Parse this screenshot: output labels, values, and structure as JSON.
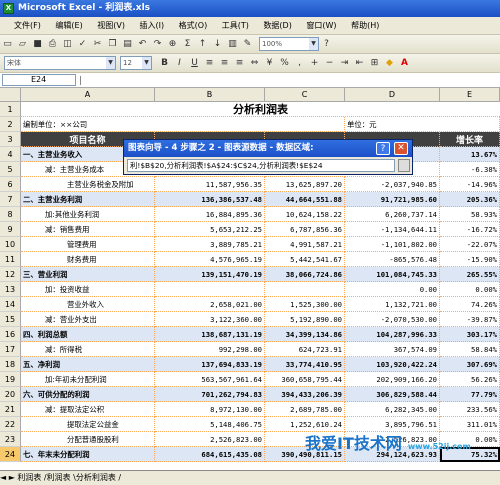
{
  "window": {
    "title": "Microsoft Excel - 利润表.xls"
  },
  "menu": [
    "文件(F)",
    "编辑(E)",
    "视图(V)",
    "插入(I)",
    "格式(O)",
    "工具(T)",
    "数据(D)",
    "窗口(W)",
    "帮助(H)"
  ],
  "toolbar": {
    "zoom": "100%",
    "font": "宋体",
    "size": "12"
  },
  "formula_bar": {
    "name_box": "E24"
  },
  "columns": [
    "A",
    "B",
    "C",
    "D",
    "E"
  ],
  "sheet": {
    "title": "分析利润表",
    "unit_label": "编制单位：××公司",
    "unit_right": "单位：元",
    "header_a": "项目名称",
    "header_e": "增长率"
  },
  "rows": [
    {
      "n": "4",
      "a": "一、主营业务收入",
      "b": "",
      "c": "",
      "d": "",
      "e": "13.67%",
      "bold": true
    },
    {
      "n": "5",
      "a": "减：主营业务成本",
      "b": "",
      "c": "",
      "d": "",
      "e": "-6.38%",
      "indent": 1
    },
    {
      "n": "6",
      "a": "主营业务税金及附加",
      "b": "11,587,956.35",
      "c": "13,625,897.20",
      "d": "-2,037,940.85",
      "e": "-14.96%",
      "indent": 2
    },
    {
      "n": "7",
      "a": "二、主营业务利润",
      "b": "136,386,537.48",
      "c": "44,664,551.88",
      "d": "91,721,985.60",
      "e": "205.36%",
      "bold": true
    },
    {
      "n": "8",
      "a": "加:其他业务利润",
      "b": "16,884,895.36",
      "c": "10,624,158.22",
      "d": "6,260,737.14",
      "e": "58.93%",
      "indent": 1
    },
    {
      "n": "9",
      "a": "减：销售费用",
      "b": "5,653,212.25",
      "c": "6,787,856.36",
      "d": "-1,134,644.11",
      "e": "-16.72%",
      "indent": 1
    },
    {
      "n": "10",
      "a": "管理费用",
      "b": "3,889,785.21",
      "c": "4,991,587.21",
      "d": "-1,101,802.00",
      "e": "-22.07%",
      "indent": 2
    },
    {
      "n": "11",
      "a": "财务费用",
      "b": "4,576,965.19",
      "c": "5,442,541.67",
      "d": "-865,576.48",
      "e": "-15.90%",
      "indent": 2
    },
    {
      "n": "12",
      "a": "三、营业利润",
      "b": "139,151,470.19",
      "c": "38,066,724.86",
      "d": "101,084,745.33",
      "e": "265.55%",
      "bold": true
    },
    {
      "n": "13",
      "a": "加：投资收益",
      "b": "",
      "c": "",
      "d": "0.00",
      "e": "0.00%",
      "indent": 1
    },
    {
      "n": "14",
      "a": "营业外收入",
      "b": "2,658,021.00",
      "c": "1,525,300.00",
      "d": "1,132,721.00",
      "e": "74.26%",
      "indent": 2
    },
    {
      "n": "15",
      "a": "减：营业外支出",
      "b": "3,122,360.00",
      "c": "5,192,890.00",
      "d": "-2,070,530.00",
      "e": "-39.87%",
      "indent": 1
    },
    {
      "n": "16",
      "a": "四、利润总额",
      "b": "138,687,131.19",
      "c": "34,399,134.86",
      "d": "104,287,996.33",
      "e": "303.17%",
      "bold": true
    },
    {
      "n": "17",
      "a": "减：所得税",
      "b": "992,298.00",
      "c": "624,723.91",
      "d": "367,574.09",
      "e": "58.84%",
      "indent": 1
    },
    {
      "n": "18",
      "a": "五、净利润",
      "b": "137,694,833.19",
      "c": "33,774,410.95",
      "d": "103,920,422.24",
      "e": "307.69%",
      "bold": true
    },
    {
      "n": "19",
      "a": "加:年初未分配利润",
      "b": "563,567,961.64",
      "c": "360,658,795.44",
      "d": "202,909,166.20",
      "e": "56.26%",
      "indent": 1
    },
    {
      "n": "20",
      "a": "六、可供分配的利润",
      "b": "701,262,794.83",
      "c": "394,433,206.39",
      "d": "306,829,588.44",
      "e": "77.79%",
      "bold": true
    },
    {
      "n": "21",
      "a": "减：提取法定公积",
      "b": "8,972,130.00",
      "c": "2,689,785.00",
      "d": "6,282,345.00",
      "e": "233.56%",
      "indent": 1
    },
    {
      "n": "22",
      "a": "提取法定公益金",
      "b": "5,148,406.75",
      "c": "1,252,610.24",
      "d": "3,895,796.51",
      "e": "311.01%",
      "indent": 2
    },
    {
      "n": "23",
      "a": "分配普通股股利",
      "b": "2,526,823.00",
      "c": "",
      "d": "2,526,823.00",
      "e": "0.00%",
      "indent": 2
    },
    {
      "n": "24",
      "a": "七、年末未分配利润",
      "b": "684,615,435.08",
      "c": "390,490,811.15",
      "d": "294,124,623.93",
      "e": "75.32%",
      "bold": true,
      "sel": true
    }
  ],
  "dialog": {
    "title": "图表向导 - 4 步骤之 2 - 图表源数据 - 数据区域:",
    "range": "利!$B$20,分析利润表!$A$24:$C$24,分析利润表!$E$24"
  },
  "sheet_tabs": "◄ ►  利润表 /利润表 \\分析利润表 /",
  "watermark": {
    "text": "我爱IT技术网",
    "url": "www.52ij.com"
  },
  "colors": {
    "titlebar": "#1b4fc4",
    "header_fill": "#404040",
    "header_text": "#ffffff",
    "selection": "#f7c96b",
    "band": "#dde6f4"
  }
}
